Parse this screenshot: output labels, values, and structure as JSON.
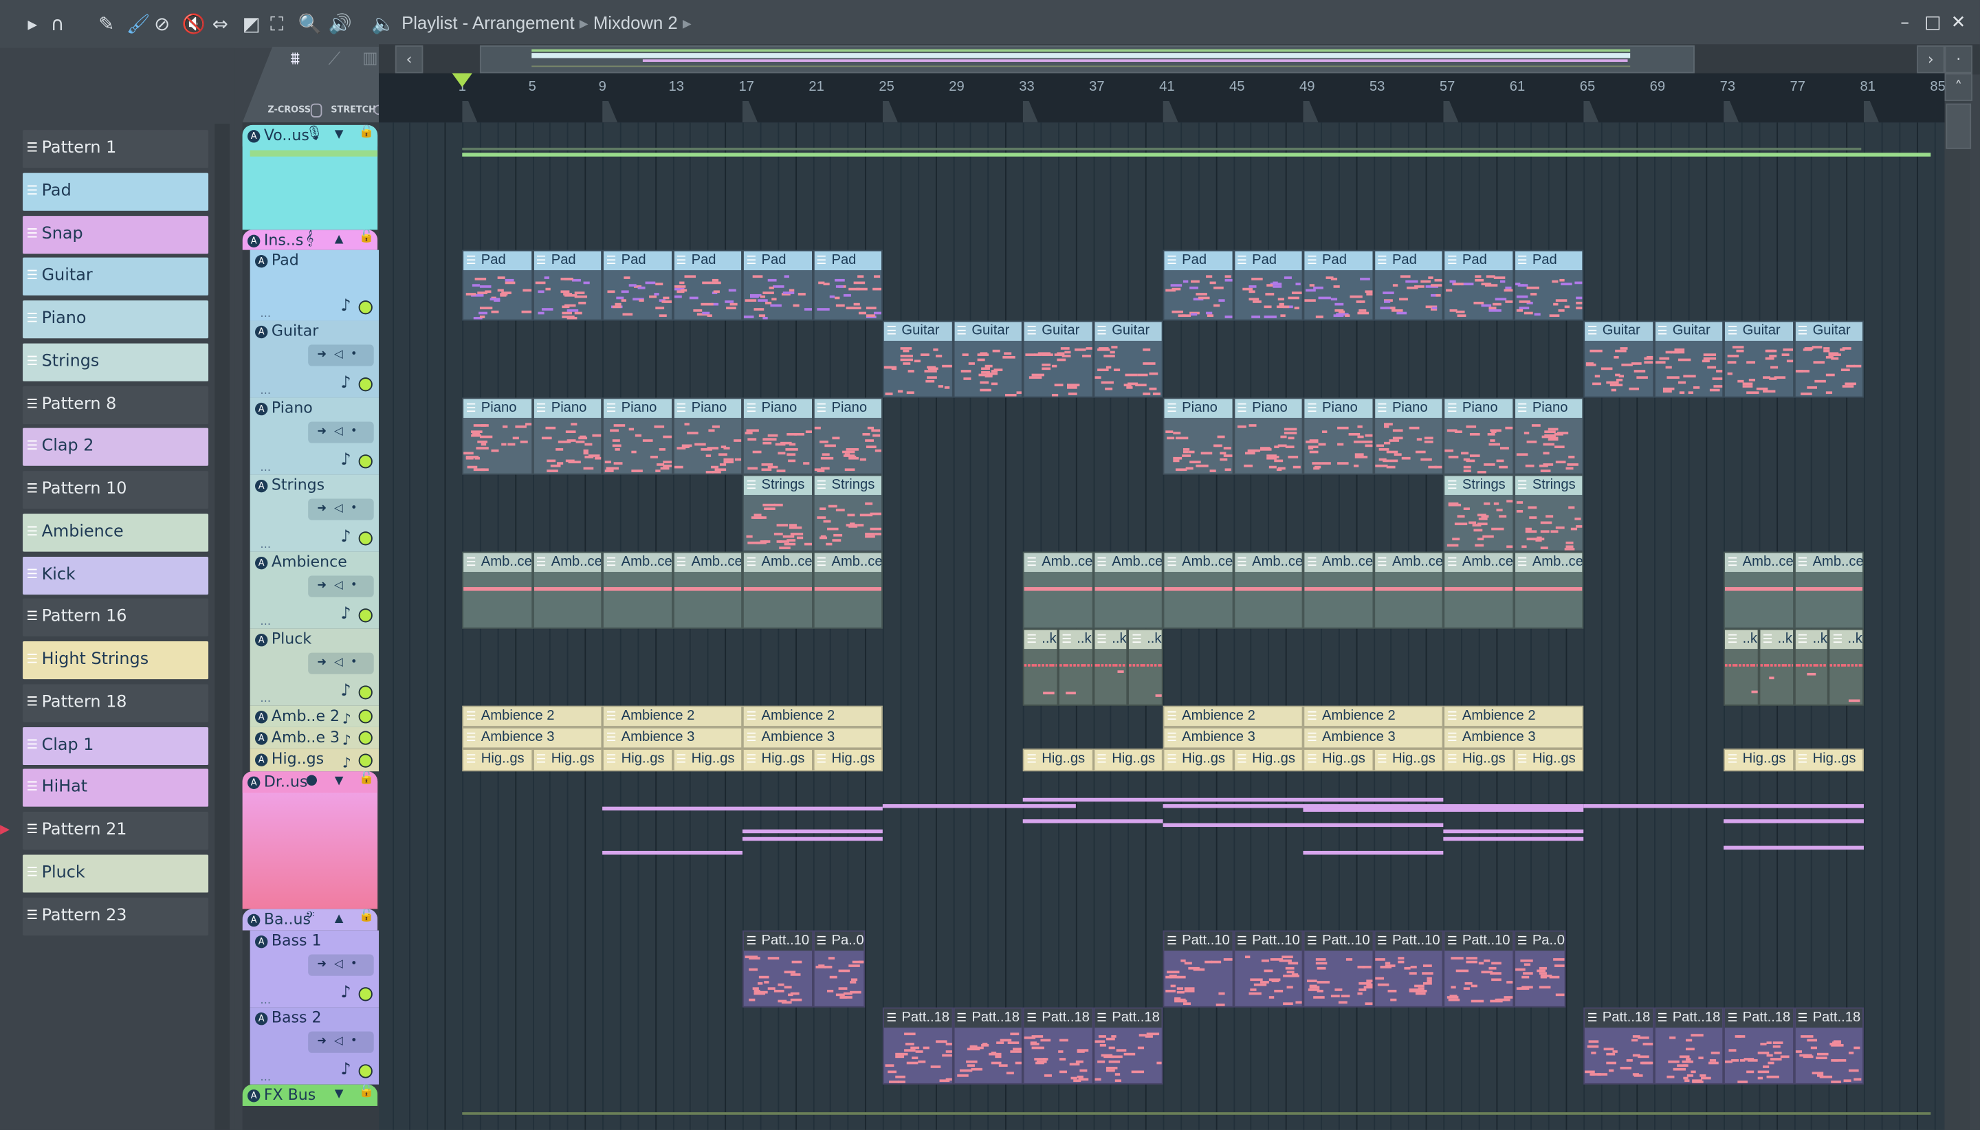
{
  "toolbar": {
    "title": "Playlist - Arrangement",
    "subtitle": "Mixdown 2",
    "icons": [
      "play-arrow-icon",
      "magnet-icon",
      "pencil-icon",
      "paint-brush-icon",
      "delete-icon",
      "mute-icon",
      "slip-icon",
      "slice-icon",
      "select-icon",
      "zoom-icon",
      "playback-icon",
      "speaker-icon"
    ],
    "window": {
      "minimize": "–",
      "maximize": "□",
      "close": "✕"
    }
  },
  "tab_labels": {
    "z_cross": "Z-CROSS",
    "stretch": "STRETCH"
  },
  "ruler": {
    "bars": [
      "1",
      "5",
      "9",
      "13",
      "17",
      "21",
      "25",
      "29",
      "33",
      "37",
      "41",
      "45",
      "49",
      "53",
      "57",
      "61",
      "65",
      "69",
      "73",
      "77",
      "81",
      "85"
    ]
  },
  "patterns": [
    {
      "name": "Pattern 1",
      "color": "",
      "dark": true
    },
    {
      "name": "Pad",
      "color": "#aad6ea"
    },
    {
      "name": "Snap",
      "color": "#dcaeea"
    },
    {
      "name": "Guitar",
      "color": "#acd4e6"
    },
    {
      "name": "Piano",
      "color": "#b6d8e2"
    },
    {
      "name": "Strings",
      "color": "#c2dcda"
    },
    {
      "name": "Pattern 8",
      "color": "",
      "dark": true
    },
    {
      "name": "Clap 2",
      "color": "#d6bcea"
    },
    {
      "name": "Pattern 10",
      "color": "",
      "dark": true
    },
    {
      "name": "Ambience",
      "color": "#c8dccc"
    },
    {
      "name": "Kick",
      "color": "#c8c2ee"
    },
    {
      "name": "Pattern 16",
      "color": "",
      "dark": true
    },
    {
      "name": "Hight Strings",
      "color": "#ece2b2"
    },
    {
      "name": "Pattern 18",
      "color": "",
      "dark": true
    },
    {
      "name": "Clap 1",
      "color": "#d4bcee"
    },
    {
      "name": "HiHat",
      "color": "#dcb0ea"
    },
    {
      "name": "Pattern 21",
      "color": "",
      "dark": true,
      "selected": true
    },
    {
      "name": "Pluck",
      "color": "#d0dcc6"
    },
    {
      "name": "Pattern 23",
      "color": "",
      "dark": true
    }
  ],
  "tracks": [
    {
      "name": "Vo..us",
      "group": true,
      "color": "#7ee2e4",
      "icon": "microphone-icon",
      "glyph": "🎙",
      "arrow": "▼"
    },
    {
      "name": "Ins..s",
      "group": true,
      "color": "#f0a2f2",
      "icon": "treble-clef-icon",
      "glyph": "𝄞",
      "arrow": "▲"
    },
    {
      "name": "Pad",
      "color": "#a6d2ee",
      "clip_hdr": "#a8d2e8",
      "clip_body": "#4f6678",
      "clips": [
        {
          "label": "Pad",
          "start": 1,
          "len": 4
        },
        {
          "label": "Pad",
          "start": 5,
          "len": 4
        },
        {
          "label": "Pad",
          "start": 9,
          "len": 4
        },
        {
          "label": "Pad",
          "start": 13,
          "len": 4
        },
        {
          "label": "Pad",
          "start": 17,
          "len": 4
        },
        {
          "label": "Pad",
          "start": 21,
          "len": 4
        },
        {
          "label": "Pad",
          "start": 41,
          "len": 4
        },
        {
          "label": "Pad",
          "start": 45,
          "len": 4
        },
        {
          "label": "Pad",
          "start": 49,
          "len": 4
        },
        {
          "label": "Pad",
          "start": 53,
          "len": 4
        },
        {
          "label": "Pad",
          "start": 57,
          "len": 4
        },
        {
          "label": "Pad",
          "start": 61,
          "len": 4
        }
      ]
    },
    {
      "name": "Guitar",
      "color": "#a9cfe2",
      "clip_hdr": "#aacfe0",
      "clip_body": "#4f6678",
      "clips": [
        {
          "label": "Guitar",
          "start": 25,
          "len": 4
        },
        {
          "label": "Guitar",
          "start": 29,
          "len": 4
        },
        {
          "label": "Guitar",
          "start": 33,
          "len": 4
        },
        {
          "label": "Guitar",
          "start": 37,
          "len": 4
        },
        {
          "label": "Guitar",
          "start": 65,
          "len": 4
        },
        {
          "label": "Guitar",
          "start": 69,
          "len": 4
        },
        {
          "label": "Guitar",
          "start": 73,
          "len": 4
        },
        {
          "label": "Guitar",
          "start": 77,
          "len": 4
        }
      ]
    },
    {
      "name": "Piano",
      "color": "#b0d4de",
      "clip_hdr": "#b2d6e0",
      "clip_body": "#566a78",
      "clips": [
        {
          "label": "Piano",
          "start": 1,
          "len": 4
        },
        {
          "label": "Piano",
          "start": 5,
          "len": 4
        },
        {
          "label": "Piano",
          "start": 9,
          "len": 4
        },
        {
          "label": "Piano",
          "start": 13,
          "len": 4
        },
        {
          "label": "Piano",
          "start": 17,
          "len": 4
        },
        {
          "label": "Piano",
          "start": 21,
          "len": 4
        },
        {
          "label": "Piano",
          "start": 41,
          "len": 4
        },
        {
          "label": "Piano",
          "start": 45,
          "len": 4
        },
        {
          "label": "Piano",
          "start": 49,
          "len": 4
        },
        {
          "label": "Piano",
          "start": 53,
          "len": 4
        },
        {
          "label": "Piano",
          "start": 57,
          "len": 4
        },
        {
          "label": "Piano",
          "start": 61,
          "len": 4
        }
      ]
    },
    {
      "name": "Strings",
      "color": "#b8d8da",
      "clip_hdr": "#b8d6d4",
      "clip_body": "#5a6e76",
      "clips": [
        {
          "label": "Strings",
          "start": 17,
          "len": 4
        },
        {
          "label": "Strings",
          "start": 21,
          "len": 4
        },
        {
          "label": "Strings",
          "start": 57,
          "len": 4
        },
        {
          "label": "Strings",
          "start": 61,
          "len": 4
        }
      ]
    },
    {
      "name": "Ambience",
      "color": "#bcd8d0",
      "clip_hdr": "#bccfc8",
      "clip_body": "#5f7472",
      "clips": [
        {
          "label": "Amb..ce",
          "start": 1,
          "len": 4
        },
        {
          "label": "Amb..ce",
          "start": 5,
          "len": 4
        },
        {
          "label": "Amb..ce",
          "start": 9,
          "len": 4
        },
        {
          "label": "Amb..ce",
          "start": 13,
          "len": 4
        },
        {
          "label": "Amb..ce",
          "start": 17,
          "len": 4
        },
        {
          "label": "Amb..ce",
          "start": 21,
          "len": 4
        },
        {
          "label": "Amb..ce",
          "start": 33,
          "len": 4
        },
        {
          "label": "Amb..ce",
          "start": 37,
          "len": 4
        },
        {
          "label": "Amb..ce",
          "start": 41,
          "len": 4
        },
        {
          "label": "Amb..ce",
          "start": 45,
          "len": 4
        },
        {
          "label": "Amb..ce",
          "start": 49,
          "len": 4
        },
        {
          "label": "Amb..ce",
          "start": 53,
          "len": 4
        },
        {
          "label": "Amb..ce",
          "start": 57,
          "len": 4
        },
        {
          "label": "Amb..ce",
          "start": 61,
          "len": 4
        },
        {
          "label": "Amb..ce",
          "start": 73,
          "len": 4
        },
        {
          "label": "Amb..ce",
          "start": 77,
          "len": 4
        }
      ]
    },
    {
      "name": "Pluck",
      "color": "#c4d8c8",
      "clip_hdr": "#c6d2c2",
      "clip_body": "#5e6f6a",
      "clips": [
        {
          "label": "..k",
          "start": 33,
          "len": 2
        },
        {
          "label": "..k",
          "start": 35,
          "len": 2
        },
        {
          "label": "..k",
          "start": 37,
          "len": 2
        },
        {
          "label": "..k",
          "start": 39,
          "len": 2
        },
        {
          "label": "..k",
          "start": 73,
          "len": 2
        },
        {
          "label": "..k",
          "start": 75,
          "len": 2
        },
        {
          "label": "..k",
          "start": 77,
          "len": 2
        },
        {
          "label": "..k",
          "start": 79,
          "len": 2
        }
      ]
    },
    {
      "name": "Amb..e 2",
      "color": "#ccdcc2",
      "clip_hdr": "#e6e0b8",
      "clips": [
        {
          "label": "Ambience 2",
          "start": 1,
          "len": 8
        },
        {
          "label": "Ambience 2",
          "start": 9,
          "len": 8
        },
        {
          "label": "Ambience 2",
          "start": 17,
          "len": 8
        },
        {
          "label": "Ambience 2",
          "start": 41,
          "len": 8
        },
        {
          "label": "Ambience 2",
          "start": 49,
          "len": 8
        },
        {
          "label": "Ambience 2",
          "start": 57,
          "len": 8
        }
      ]
    },
    {
      "name": "Amb..e 3",
      "color": "#d4dcbc",
      "clip_hdr": "#e8e2ba",
      "clips": [
        {
          "label": "Ambience 3",
          "start": 1,
          "len": 8
        },
        {
          "label": "Ambience 3",
          "start": 9,
          "len": 8
        },
        {
          "label": "Ambience 3",
          "start": 17,
          "len": 8
        },
        {
          "label": "Ambience 3",
          "start": 41,
          "len": 8
        },
        {
          "label": "Ambience 3",
          "start": 49,
          "len": 8
        },
        {
          "label": "Ambience 3",
          "start": 57,
          "len": 8
        }
      ]
    },
    {
      "name": "Hig..gs",
      "color": "#dedcb4",
      "clip_hdr": "#ebe3b8",
      "clips": [
        {
          "label": "Hig..gs",
          "start": 1,
          "len": 4
        },
        {
          "label": "Hig..gs",
          "start": 5,
          "len": 4
        },
        {
          "label": "Hig..gs",
          "start": 9,
          "len": 4
        },
        {
          "label": "Hig..gs",
          "start": 13,
          "len": 4
        },
        {
          "label": "Hig..gs",
          "start": 17,
          "len": 4
        },
        {
          "label": "Hig..gs",
          "start": 21,
          "len": 4
        },
        {
          "label": "Hig..gs",
          "start": 33,
          "len": 4
        },
        {
          "label": "Hig..gs",
          "start": 37,
          "len": 4
        },
        {
          "label": "Hig..gs",
          "start": 41,
          "len": 4
        },
        {
          "label": "Hig..gs",
          "start": 45,
          "len": 4
        },
        {
          "label": "Hig..gs",
          "start": 49,
          "len": 4
        },
        {
          "label": "Hig..gs",
          "start": 53,
          "len": 4
        },
        {
          "label": "Hig..gs",
          "start": 57,
          "len": 4
        },
        {
          "label": "Hig..gs",
          "start": 61,
          "len": 4
        },
        {
          "label": "Hig..gs",
          "start": 73,
          "len": 4
        },
        {
          "label": "Hig..gs",
          "start": 77,
          "len": 4
        }
      ]
    },
    {
      "name": "Dr..us",
      "group": true,
      "color": "#f294d4",
      "icon": "drum-icon",
      "glyph": "●",
      "arrow": "▼"
    },
    {
      "name": "Ba..us",
      "group": true,
      "color": "#c2b2f2",
      "icon": "bass-clef-icon",
      "glyph": "𝄢",
      "arrow": "▲"
    },
    {
      "name": "Bass 1",
      "color": "#b8acf0",
      "clip_hdr": "#3b444c",
      "clip_body": "#5f5b8a",
      "light_text": true,
      "clips": [
        {
          "label": "Patt..10",
          "start": 17,
          "len": 4
        },
        {
          "label": "Pa..0",
          "start": 21,
          "len": 3
        },
        {
          "label": "Patt..10",
          "start": 41,
          "len": 4
        },
        {
          "label": "Patt..10",
          "start": 45,
          "len": 4
        },
        {
          "label": "Patt..10",
          "start": 49,
          "len": 4
        },
        {
          "label": "Patt..10",
          "start": 53,
          "len": 4
        },
        {
          "label": "Patt..10",
          "start": 57,
          "len": 4
        },
        {
          "label": "Pa..0",
          "start": 61,
          "len": 3
        }
      ]
    },
    {
      "name": "Bass 2",
      "color": "#b0a8ec",
      "clip_hdr": "#3b444c",
      "clip_body": "#5f5b8a",
      "light_text": true,
      "clips": [
        {
          "label": "Patt..18",
          "start": 25,
          "len": 4
        },
        {
          "label": "Patt..18",
          "start": 29,
          "len": 4
        },
        {
          "label": "Patt..18",
          "start": 33,
          "len": 4
        },
        {
          "label": "Patt..18",
          "start": 37,
          "len": 4
        },
        {
          "label": "Patt..18",
          "start": 65,
          "len": 4
        },
        {
          "label": "Patt..18",
          "start": 69,
          "len": 4
        },
        {
          "label": "Patt..18",
          "start": 73,
          "len": 4
        },
        {
          "label": "Patt..18",
          "start": 77,
          "len": 4
        }
      ]
    },
    {
      "name": "FX Bus",
      "group": true,
      "color": "#7ed870",
      "icon": "fx-icon",
      "glyph": "",
      "arrow": "▼"
    }
  ]
}
